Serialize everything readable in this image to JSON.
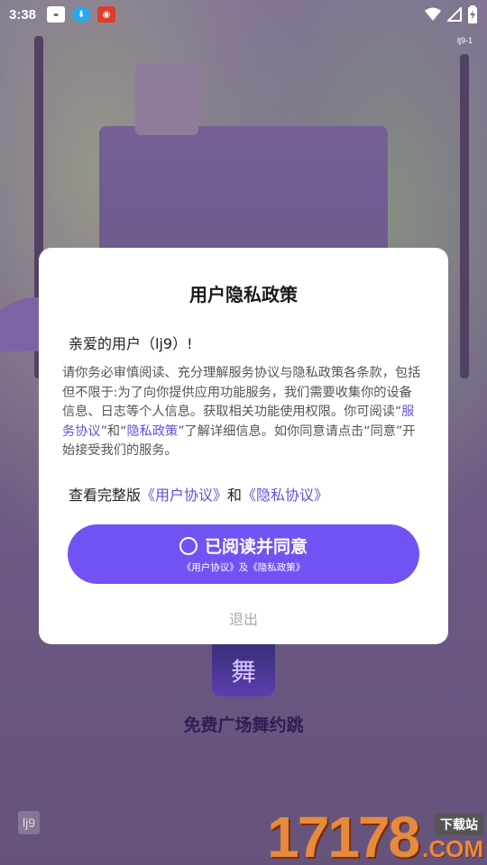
{
  "status_bar": {
    "time": "3:38",
    "icons": [
      "app-thumbnail-icon",
      "download-icon",
      "app-red-icon"
    ],
    "right_icons": [
      "wifi-icon",
      "signal-icon",
      "battery-icon"
    ]
  },
  "top_tag": "lj9-1",
  "dialog": {
    "title": "用户隐私政策",
    "greeting": "亲爱的用户（lj9）!",
    "body_prefix": "请你务必审慎阅读、充分理解服务协议与隐私政策各条款，包括但不限于:为了向你提供应用功能服务，我们需要收集你的设备信息、日志等个人信息。获取相关功能使用权限。你可阅读“",
    "body_link1": "服务协议",
    "body_mid": "”和“",
    "body_link2": "隐私政策",
    "body_suffix": "”了解详细信息。如你同意请点击“同意”开始接受我们的服务。",
    "view_prefix": "查看完整版",
    "view_link1": "《用户协议》",
    "view_and": "和",
    "view_link2": "《隐私协议》",
    "agree_label": "已阅读并同意",
    "agree_sub": "《用户协议》及《隐私政策》",
    "exit_label": "退出"
  },
  "app": {
    "icon_glyph": "舞",
    "name": "免费广场舞约跳"
  },
  "corner_badge": "lj9",
  "watermark": {
    "number": "17178",
    "tag": "下载站",
    "suffix": ".COM"
  },
  "colors": {
    "accent": "#7352f4",
    "link": "#6a4ddc"
  }
}
